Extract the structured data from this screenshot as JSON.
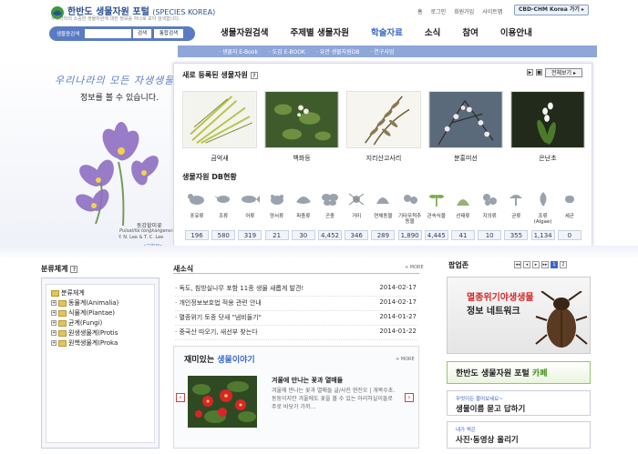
{
  "header": {
    "logo_title": "한반도 생물자원 포털",
    "logo_title_en": "(SPECIES KOREA)",
    "logo_sub": "우리나라의 소중한 생물자원에 대한 정보를 하나로 모아 검색합니다.",
    "top_links": [
      "홈",
      "로그인",
      "회원가입",
      "사이트맵"
    ],
    "cbd_button": "CBD-CHM Korea 가기 ▸"
  },
  "search": {
    "label": "생물종검색",
    "search_button": "검색",
    "advanced_button": "통합검색"
  },
  "nav": {
    "items": [
      "생물자원검색",
      "주제별 생물자원",
      "학술자료",
      "소식",
      "참여",
      "이용안내"
    ],
    "active_index": 2
  },
  "subnav": {
    "items": [
      "· 생물지 E-Book",
      "· 도감 E-BOOK",
      "· 유관 생물자원DB",
      "· 연구사업"
    ]
  },
  "hero": {
    "line1": "우리나라의 모든 자생생물",
    "line2": "정보를 볼 수 있습니다.",
    "caption_name": "동강할미꽃",
    "caption_sci": "Pulsatilla tongkangensis",
    "caption_author": "Y. N. Lee & T. C. Lee",
    "caption_more": "[고화질]"
  },
  "new_resources": {
    "title": "새로 등록된 생물자원",
    "view_all": "전체보기 ▸",
    "items": [
      "금억새",
      "백화등",
      "지리산고사리",
      "분홍미선",
      "은난초"
    ]
  },
  "db_status": {
    "title": "생물자원 DB현황",
    "categories": [
      {
        "label": "포유류",
        "count": "196"
      },
      {
        "label": "조류",
        "count": "580"
      },
      {
        "label": "어류",
        "count": "319"
      },
      {
        "label": "양서류",
        "count": "21"
      },
      {
        "label": "파충류",
        "count": "30"
      },
      {
        "label": "곤충",
        "count": "4,452"
      },
      {
        "label": "거미",
        "count": "346"
      },
      {
        "label": "연체동물",
        "count": "289"
      },
      {
        "label": "기타무척추동물",
        "count": "1,890"
      },
      {
        "label": "관속식물",
        "count": "4,445"
      },
      {
        "label": "선태류",
        "count": "41"
      },
      {
        "label": "지의류",
        "count": "10"
      },
      {
        "label": "균류",
        "count": "355"
      },
      {
        "label": "조류(Algae)",
        "count": "1,134"
      },
      {
        "label": "세균",
        "count": "0"
      }
    ]
  },
  "classification": {
    "title": "분류체계",
    "items": [
      "분류체계",
      "동물계(Animalia)",
      "식물계(Plantae)",
      "균계(Fungi)",
      "원생생물계(Protis",
      "원핵생물계(Proka"
    ]
  },
  "news": {
    "title": "새소식",
    "more": "MORE",
    "items": [
      {
        "text": "· 독도, 침방실나무 포함 11종 생물 새롭게 발견!",
        "date": "2014-02-17"
      },
      {
        "text": "· 개인정보보호법 적용 관련 안내",
        "date": "2014-02-17"
      },
      {
        "text": "· 멸종위기 토종 닷새 \"냄비들기\"",
        "date": "2014-01-27"
      },
      {
        "text": "· 중국산 따오기, 새선부 찾는다",
        "date": "2014-01-22"
      }
    ]
  },
  "story": {
    "title_prefix": "재미있는 ",
    "title_highlight": "생물이야기",
    "more": "MORE",
    "headline": "겨울에 만나는 꽃과 열매들",
    "body": "겨울에 만나는 꽃과 열매들 글/사진 현진오 | 개복수초. 동둥이지만 겨울에도 꽃을 볼 수 있는 아리하실이들로 주로 바닷가 가까..."
  },
  "popup": {
    "title": "팝업존",
    "pages": [
      "◂◂",
      "◂",
      "▸",
      "▸▸",
      "1",
      "2"
    ],
    "banner_line1": "멸종위기야생생물",
    "banner_line2": "정보 네트워크",
    "cafe_prefix": "한반도 생물자원 포털 ",
    "cafe_highlight": "카페",
    "qa_small": "무엇이든 물어보세요~",
    "qa_big": "생물이름 묻고 답하기",
    "photo_small": "내가 찍은",
    "photo_big": "사진·동영상 올리기"
  },
  "colors": {
    "accent": "#3c67c9",
    "nav_bar": "#8ea6d8",
    "banner_red": "#d32a2a",
    "cafe_green": "#3e8e1a"
  }
}
